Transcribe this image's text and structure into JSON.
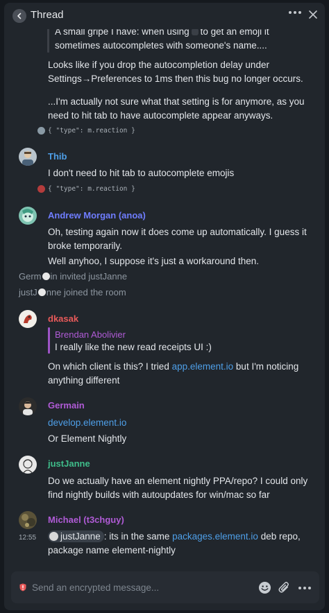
{
  "header": {
    "title": "Thread"
  },
  "messages": {
    "m1_cut_a": "A small gripe I have: when using",
    "m1_cut_b": "to get an emoji it",
    "m1_line2": "sometimes autocompletes with someone's name....",
    "m1_para2": "Looks like if you drop the autocompletion delay under Settings→Preferences to 1ms then this bug no longer occurs.",
    "m1_para3": "...I'm actually not sure what that setting is for anymore, as you need to hit tab to have autocomplete appear anyways.",
    "reaction1": "{ \"type\": m.reaction }",
    "thib_name": "Thib",
    "thib_text": "I don't need to hit tab to autocomplete emojis",
    "reaction2": "{ \"type\": m.reaction }",
    "andrew_name": "Andrew Morgan (anoa)",
    "andrew_text1": "Oh, testing again now it does come up automatically. I guess it broke temporarily.",
    "andrew_text2": "Well anyhoo, I suppose it's just a workaround then.",
    "state1_a": "Germ",
    "state1_b": "in invited justJanne",
    "state2_a": "justJ",
    "state2_b": "nne joined the room",
    "dkasak_name": "dkasak",
    "reply_name": "Brendan Abolivier",
    "reply_text": "I really like the new read receipts UI :)",
    "dkasak_text_a": "On which client is this? I tried",
    "dkasak_link": "app.element.io",
    "dkasak_text_b": "but I'm noticing anything different",
    "germain_name": "Germain",
    "germain_link": "develop.element.io",
    "germain_text": "Or Element Nightly",
    "janne_name": "justJanne",
    "janne_text": "Do we actually have an element nightly PPA/repo? I could only find nightly builds with autoupdates for win/mac so far",
    "michael_name": "Michael (t3chguy)",
    "michael_time": "12:55",
    "michael_pill": "justJanne",
    "michael_text_a": ": its in the same",
    "michael_link": "packages.element.io",
    "michael_text_b": "deb repo, package name element-nightly"
  },
  "composer": {
    "placeholder": "Send an encrypted message..."
  },
  "colors": {
    "thib": "#4e9fe8",
    "andrew": "#6f7dff",
    "dkasak": "#e85a5a",
    "brendan": "#b05bd6",
    "germain": "#b05bd6",
    "janne": "#3fbd8a",
    "michael": "#b05bd6",
    "link": "#4e9fe8"
  },
  "icons": [
    "back-arrow-icon",
    "more-options-icon",
    "close-icon",
    "shield-icon",
    "emoji-icon",
    "attachment-icon",
    "composer-more-icon"
  ]
}
